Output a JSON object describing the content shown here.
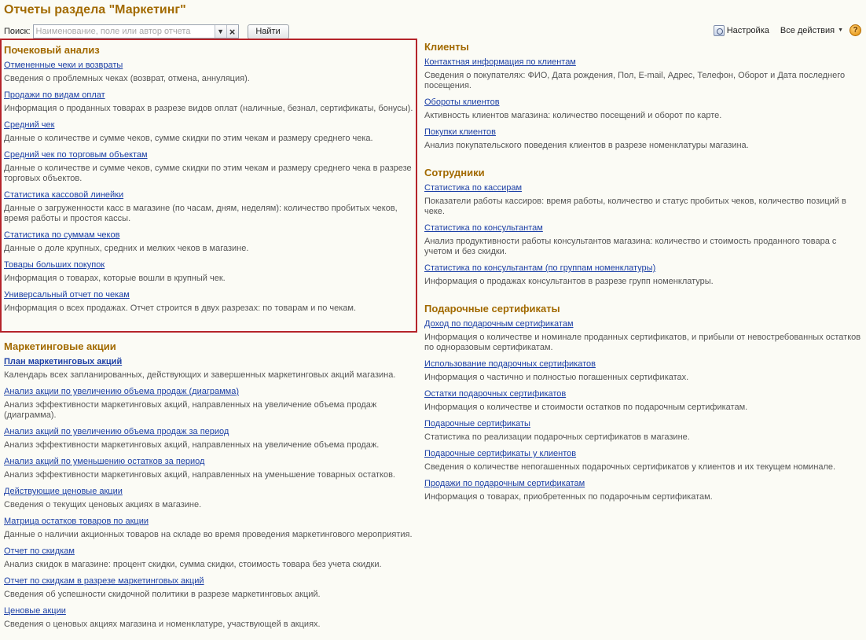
{
  "page": {
    "title": "Отчеты раздела \"Маркетинг\""
  },
  "search": {
    "label": "Поиск:",
    "placeholder": "Наименование, поле или автор отчета",
    "find_label": "Найти"
  },
  "tools": {
    "settings_label": "Настройка",
    "all_actions_label": "Все действия",
    "help_label": "?"
  },
  "icons": {
    "settings": "settings-icon",
    "dropdown": "chevron-down-icon",
    "clear": "close-icon",
    "help": "help-icon"
  },
  "colors": {
    "group_title": "#a26a00",
    "link": "#1d40a6",
    "highlight_border": "#b5242a"
  },
  "groups_left": [
    {
      "title": "Почековый анализ",
      "items": [
        {
          "label": "Отмененные чеки и возвраты",
          "desc": "Сведения о проблемных чеках (возврат, отмена, аннуляция)."
        },
        {
          "label": "Продажи по видам оплат",
          "desc": "Информация о проданных товарах в разрезе видов оплат (наличные, безнал, сертификаты, бонусы)."
        },
        {
          "label": "Средний чек",
          "desc": "Данные о количестве и сумме чеков, сумме скидки по этим чекам и размеру среднего чека."
        },
        {
          "label": "Средний чек по торговым объектам",
          "desc": "Данные о количестве и сумме чеков, сумме скидки по этим чекам и размеру среднего чека в разрезе торговых объектов."
        },
        {
          "label": "Статистика кассовой линейки",
          "desc": "Данные о загруженности касс в магазине (по часам, дням, неделям): количество пробитых чеков, время работы и простоя кассы."
        },
        {
          "label": "Статистика по суммам чеков",
          "desc": "Данные о доле крупных, средних и мелких чеков в магазине."
        },
        {
          "label": "Товары больших покупок",
          "desc": "Информация о товарах, которые вошли в крупный чек."
        },
        {
          "label": "Универсальный отчет по чекам",
          "desc": "Информация о всех продажах. Отчет строится в двух разрезах: по товарам и по чекам."
        }
      ]
    },
    {
      "title": "Маркетинговые акции",
      "items": [
        {
          "label": "План маркетинговых акций",
          "desc": "Календарь всех запланированных, действующих и завершенных маркетинговых акций магазина."
        },
        {
          "label": "Анализ акции по увеличению объема продаж (диаграмма)",
          "desc": "Анализ эффективности маркетинговых акций, направленных на увеличение объема продаж (диаграмма)."
        },
        {
          "label": "Анализ акций по увеличению объема продаж за период",
          "desc": "Анализ эффективности маркетинговых акций, направленных на увеличение объема продаж."
        },
        {
          "label": "Анализ акций по уменьшению остатков за период",
          "desc": "Анализ эффективности маркетинговых акций, направленных на уменьшение товарных остатков."
        },
        {
          "label": "Действующие ценовые акции",
          "desc": "Сведения о текущих ценовых акциях в магазине."
        },
        {
          "label": "Матрица остатков товаров по акции",
          "desc": "Данные о наличии акционных товаров на складе во время проведения маркетингового мероприятия."
        },
        {
          "label": "Отчет по скидкам",
          "desc": "Анализ скидок в магазине: процент скидки, сумма скидки, стоимость товара без учета скидки."
        },
        {
          "label": "Отчет по скидкам в разрезе маркетинговых акций",
          "desc": "Сведения об успешности скидочной политики в разрезе маркетинговых акций."
        },
        {
          "label": "Ценовые акции",
          "desc": "Сведения о ценовых акциях магазина и номенклатуре, участвующей в акциях."
        }
      ]
    }
  ],
  "groups_right": [
    {
      "title": "Клиенты",
      "items": [
        {
          "label": "Контактная информация по клиентам",
          "desc": "Сведения о покупателях: ФИО, Дата рождения, Пол, E-mail, Адрес, Телефон, Оборот и Дата последнего посещения."
        },
        {
          "label": "Обороты клиентов",
          "desc": "Активность клиентов магазина: количество посещений и оборот по карте."
        },
        {
          "label": "Покупки клиентов",
          "desc": "Анализ покупательского поведения клиентов в разрезе номенклатуры магазина."
        }
      ]
    },
    {
      "title": "Сотрудники",
      "items": [
        {
          "label": "Статистика по кассирам",
          "desc": "Показатели работы кассиров: время работы, количество и статус пробитых чеков, количество позиций в чеке."
        },
        {
          "label": "Статистика по консультантам",
          "desc": "Анализ продуктивности работы консультантов магазина: количество и стоимость проданного товара с учетом и без скидки."
        },
        {
          "label": "Статистика по консультантам (по группам номенклатуры)",
          "desc": "Информация о продажах консультантов в разрезе групп номенклатуры."
        }
      ]
    },
    {
      "title": "Подарочные сертификаты",
      "items": [
        {
          "label": "Доход по подарочным сертификатам",
          "desc": "Информация о количестве и номинале проданных сертификатов, и прибыли от невостребованных остатков по одноразовым сертификатам."
        },
        {
          "label": "Использование подарочных сертификатов",
          "desc": "Информация о частично и полностью погашенных сертификатах."
        },
        {
          "label": "Остатки подарочных сертификатов",
          "desc": "Информация о количестве и стоимости остатков по подарочным сертификатам."
        },
        {
          "label": "Подарочные сертификаты",
          "desc": "Статистика по реализации подарочных сертификатов в магазине."
        },
        {
          "label": "Подарочные сертификаты у клиентов",
          "desc": "Сведения о количестве непогашенных подарочных сертификатов у клиентов и их текущем номинале."
        },
        {
          "label": "Продажи по подарочным сертификатам",
          "desc": "Информация о товарах, приобретенных по подарочным сертификатам."
        }
      ]
    }
  ]
}
